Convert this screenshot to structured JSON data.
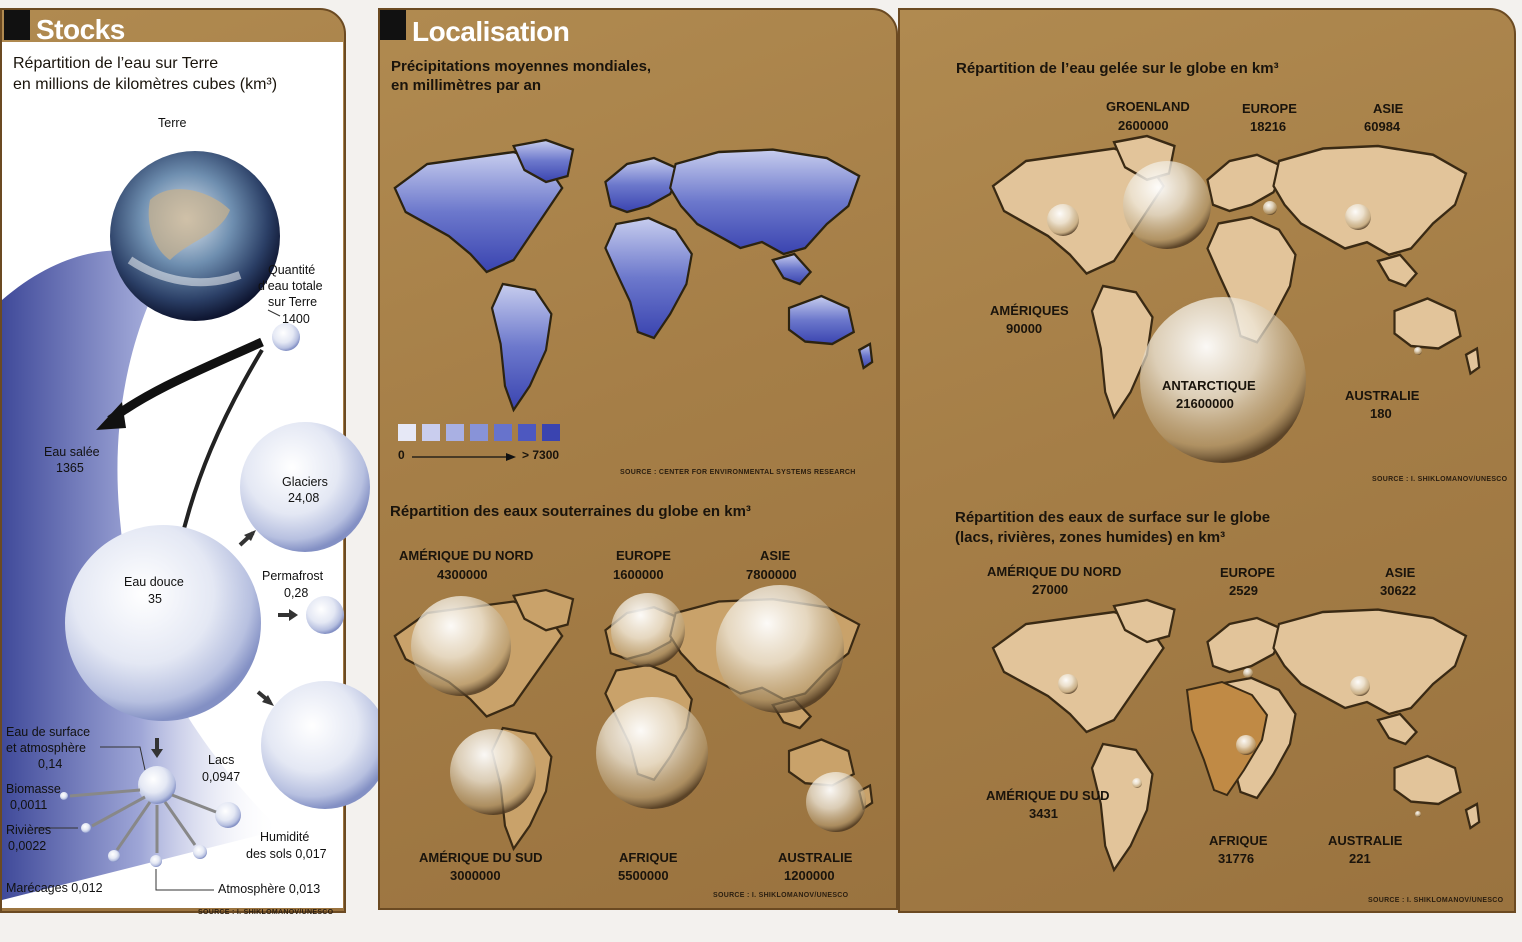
{
  "stocks": {
    "title": "Stocks",
    "subtitle_line1": "Répartition de l’eau sur Terre",
    "subtitle_line2": "en millions de kilomètres cubes (km³)",
    "earth_label": "Terre",
    "total_label_1": "Quantité",
    "total_label_2": "d’eau totale",
    "total_label_3": "sur Terre",
    "total_value": "1400",
    "salt_label": "Eau salée",
    "salt_value": "1365",
    "glaciers_label": "Glaciers",
    "glaciers_value": "24,08",
    "fresh_label": "Eau douce",
    "fresh_value": "35",
    "permafrost_label": "Permafrost",
    "permafrost_value": "0,28",
    "surface_label_1": "Eau de surface",
    "surface_label_2": "et atmosphère",
    "surface_value": "0,14",
    "lakes_label": "Lacs",
    "lakes_value": "0,0947",
    "biomass_label": "Biomasse",
    "biomass_value": "0,0011",
    "rivers_label": "Rivières",
    "rivers_value": "0,0022",
    "humidity_label": "Humidité",
    "humidity_value": "des sols 0,017",
    "marshes": "Marécages 0,012",
    "atmosphere": "Atmosphère 0,013",
    "source": "SOURCE : I. SHIKLOMANOV/UNESCO"
  },
  "localisation": {
    "title": "Localisation",
    "precip_title_1": "Précipitations moyennes mondiales,",
    "precip_title_2": "en millimètres par an",
    "legend_min": "0",
    "legend_max": "> 7300",
    "legend_colors": [
      "#e6e8f6",
      "#c9cdee",
      "#a9b0e3",
      "#8893d8",
      "#6773cc",
      "#4d58c0",
      "#3a44b0"
    ],
    "precip_source": "SOURCE : CENTER FOR ENVIRONMENTAL SYSTEMS RESEARCH",
    "ground_title": "Répartition des eaux souterraines du globe en km³",
    "ground": {
      "na_label": "AMÉRIQUE DU NORD",
      "na_value": "4300000",
      "eu_label": "EUROPE",
      "eu_value": "1600000",
      "as_label": "ASIE",
      "as_value": "7800000",
      "sa_label": "AMÉRIQUE DU SUD",
      "sa_value": "3000000",
      "af_label": "AFRIQUE",
      "af_value": "5500000",
      "au_label": "AUSTRALIE",
      "au_value": "1200000"
    },
    "ground_source": "SOURCE : I. SHIKLOMANOV/UNESCO"
  },
  "ice": {
    "title": "Répartition de l’eau gelée sur le globe  en km³",
    "gr_label": "GROENLAND",
    "gr_value": "2600000",
    "eu_label": "EUROPE",
    "eu_value": "18216",
    "as_label": "ASIE",
    "as_value": "60984",
    "am_label": "AMÉRIQUES",
    "am_value": "90000",
    "an_label": "ANTARCTIQUE",
    "an_value": "21600000",
    "au_label": "AUSTRALIE",
    "au_value": "180",
    "source": "SOURCE : I. SHIKLOMANOV/UNESCO"
  },
  "surface": {
    "title_1": "Répartition des eaux de surface sur le globe",
    "title_2": "(lacs, rivières, zones humides) en km³",
    "na_label": "AMÉRIQUE DU NORD",
    "na_value": "27000",
    "eu_label": "EUROPE",
    "eu_value": "2529",
    "as_label": "ASIE",
    "as_value": "30622",
    "sa_label": "AMÉRIQUE DU SUD",
    "sa_value": "3431",
    "af_label": "AFRIQUE",
    "af_value": "31776",
    "au_label": "AUSTRALIE",
    "au_value": "221",
    "source": "SOURCE : I. SHIKLOMANOV/UNESCO"
  }
}
